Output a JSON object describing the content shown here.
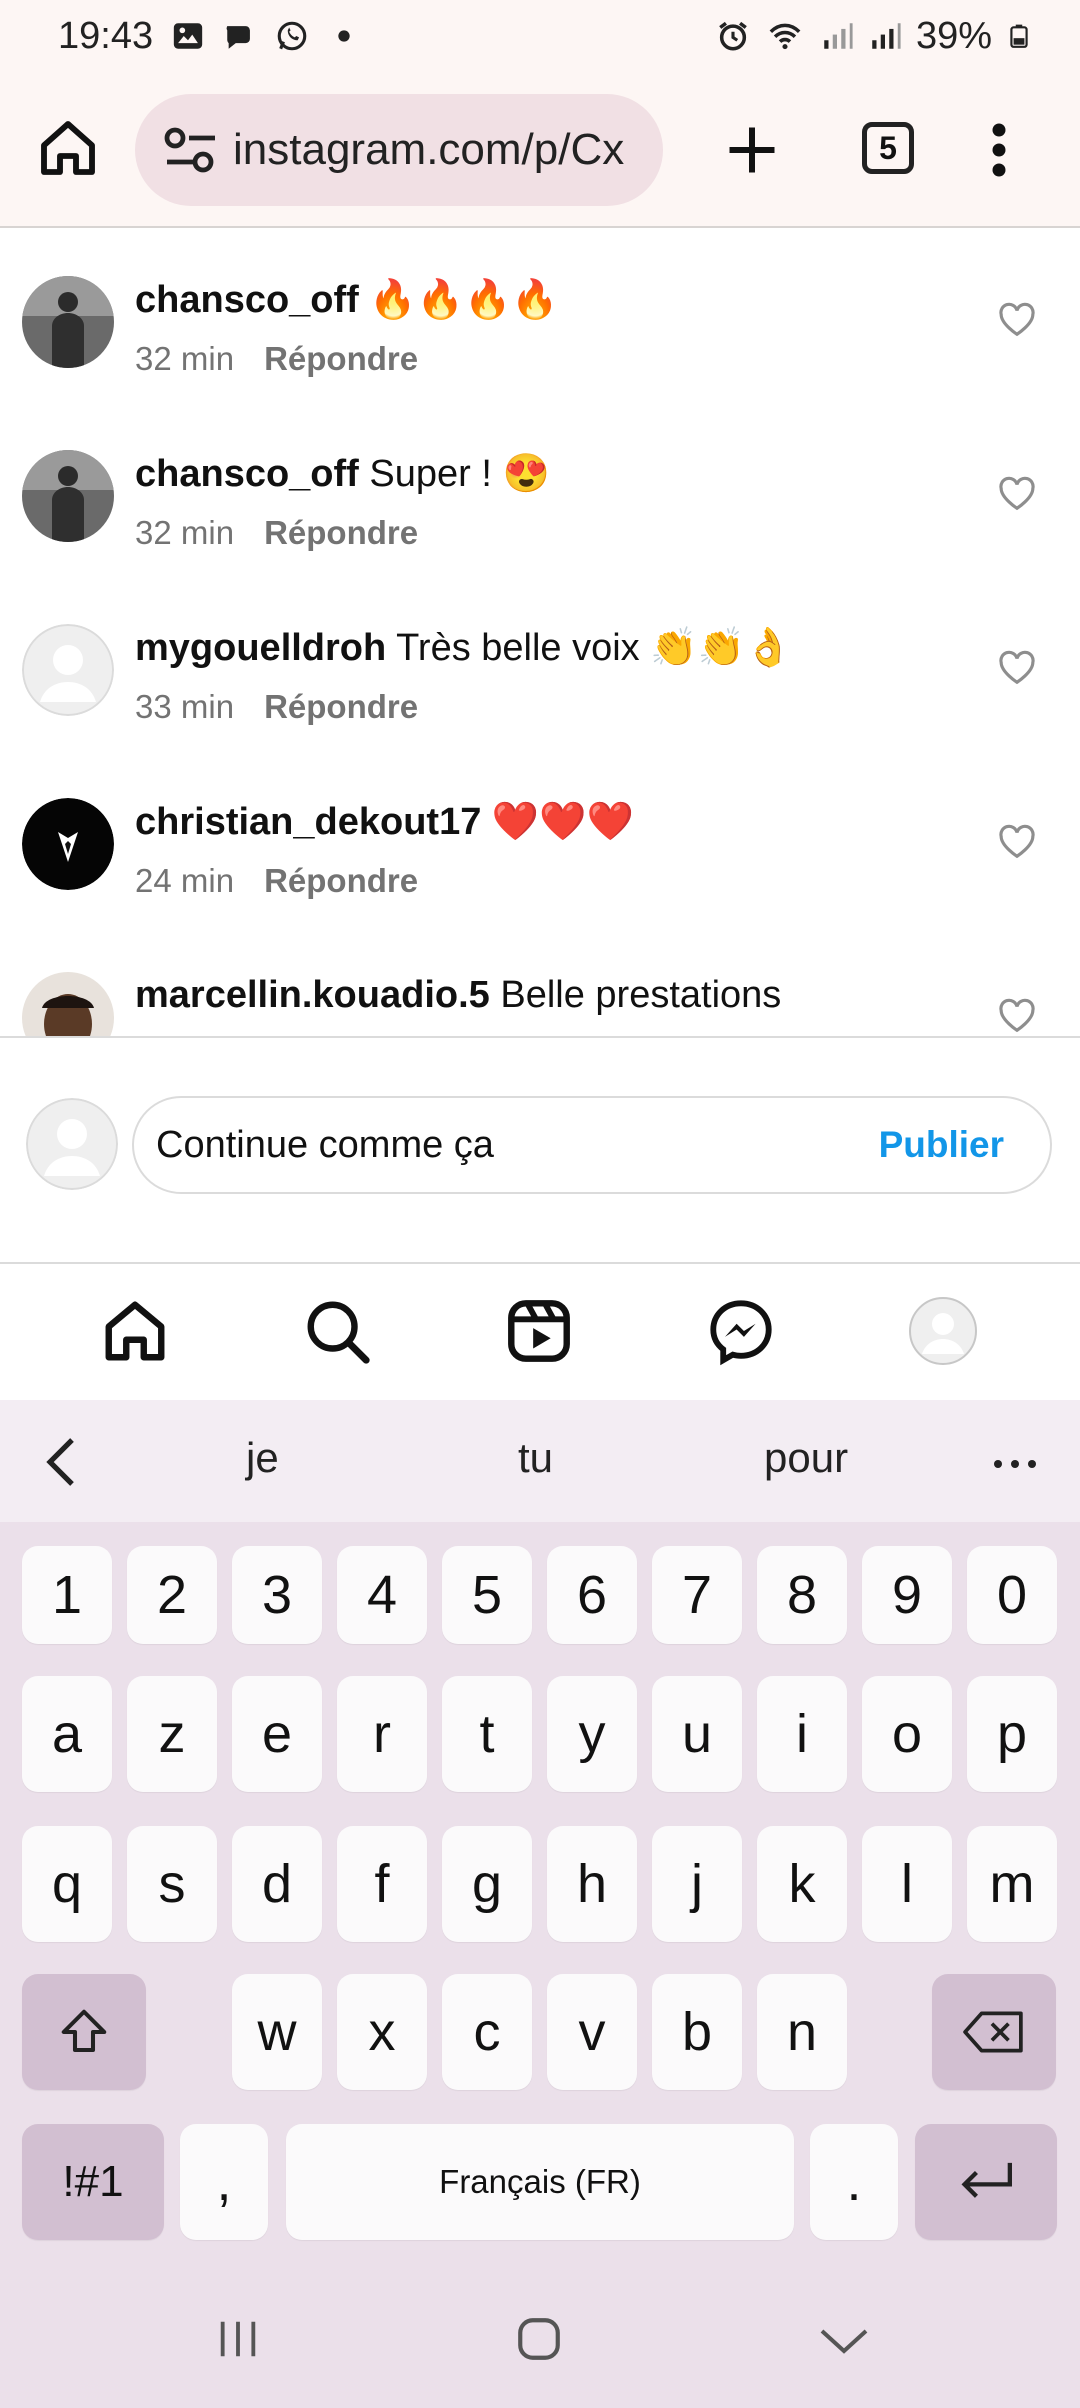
{
  "status_bar": {
    "time": "19:43",
    "battery": "39%",
    "icons": [
      "photo-icon",
      "chat-icon",
      "whatsapp-icon",
      "dot-icon",
      "alarm-icon",
      "wifi-icon",
      "signal-icon",
      "signal-icon",
      "battery-icon"
    ]
  },
  "browser": {
    "url": "instagram.com/p/Cx",
    "tab_count": "5"
  },
  "comments": [
    {
      "user": "chansco_off",
      "text": "🔥🔥🔥🔥",
      "time": "32 min",
      "reply": "Répondre",
      "avatar": "photo"
    },
    {
      "user": "chansco_off",
      "text": "Super ! 😍",
      "time": "32 min",
      "reply": "Répondre",
      "avatar": "photo"
    },
    {
      "user": "mygouelldroh",
      "text": "Très belle voix 👏👏👌",
      "time": "33 min",
      "reply": "Répondre",
      "avatar": "default"
    },
    {
      "user": "christian_dekout17",
      "text": "❤️❤️❤️",
      "time": "24 min",
      "reply": "Répondre",
      "avatar": "suit"
    },
    {
      "user": "marcellin.kouadio.5",
      "text": "Belle prestations",
      "time": "",
      "reply": "",
      "avatar": "face"
    }
  ],
  "comment_input": {
    "value": "Continue comme ça",
    "publish_label": "Publier"
  },
  "ig_nav": [
    "home-icon",
    "search-icon",
    "reels-icon",
    "messenger-icon",
    "profile-avatar"
  ],
  "keyboard": {
    "suggestions": [
      "je",
      "tu",
      "pour"
    ],
    "numbers": [
      "1",
      "2",
      "3",
      "4",
      "5",
      "6",
      "7",
      "8",
      "9",
      "0"
    ],
    "row1": [
      "a",
      "z",
      "e",
      "r",
      "t",
      "y",
      "u",
      "i",
      "o",
      "p"
    ],
    "row2": [
      "q",
      "s",
      "d",
      "f",
      "g",
      "h",
      "j",
      "k",
      "l",
      "m"
    ],
    "row3": [
      "w",
      "x",
      "c",
      "v",
      "b",
      "n"
    ],
    "symbols_label": "!#1",
    "comma": ",",
    "space_label": "Français (FR)",
    "period": "."
  },
  "colors": {
    "accent": "#1296e8",
    "keyboard_bg": "#ebe0ea",
    "dark_key": "#d2bfd1",
    "url_bg": "#f1e0e4"
  }
}
